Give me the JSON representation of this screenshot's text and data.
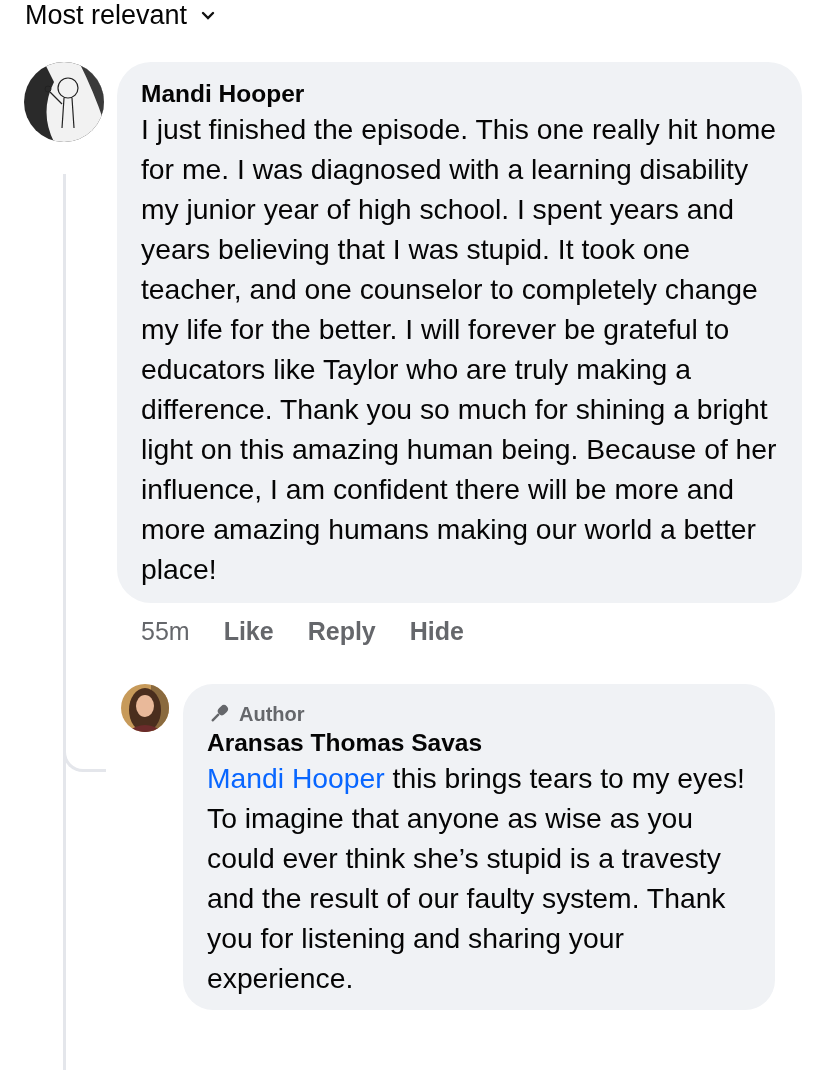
{
  "sort": {
    "label": "Most relevant"
  },
  "comment": {
    "author": "Mandi Hooper",
    "text": "I just finished the episode. This one really hit home for me. I was diagnosed with a learning disability my junior year of high school. I spent years and years believing that I was stupid. It took one teacher, and one counselor to completely change my life for the better. I will forever be grateful to educators like Taylor who are truly making a difference. Thank you so much for shining a bright light on this amazing human being. Because of her influence, I am confident there will be more and more amazing humans making our world a better place!",
    "time": "55m",
    "actions": [
      "Like",
      "Reply",
      "Hide"
    ]
  },
  "reply": {
    "badge": "Author",
    "author": "Aransas Thomas Savas",
    "mention": "Mandi Hooper",
    "text": "this brings tears to my eyes! To imagine that anyone as wise as you could ever think she’s stupid is a travesty and the result of our faulty system. Thank you for listening and sharing your experience."
  }
}
